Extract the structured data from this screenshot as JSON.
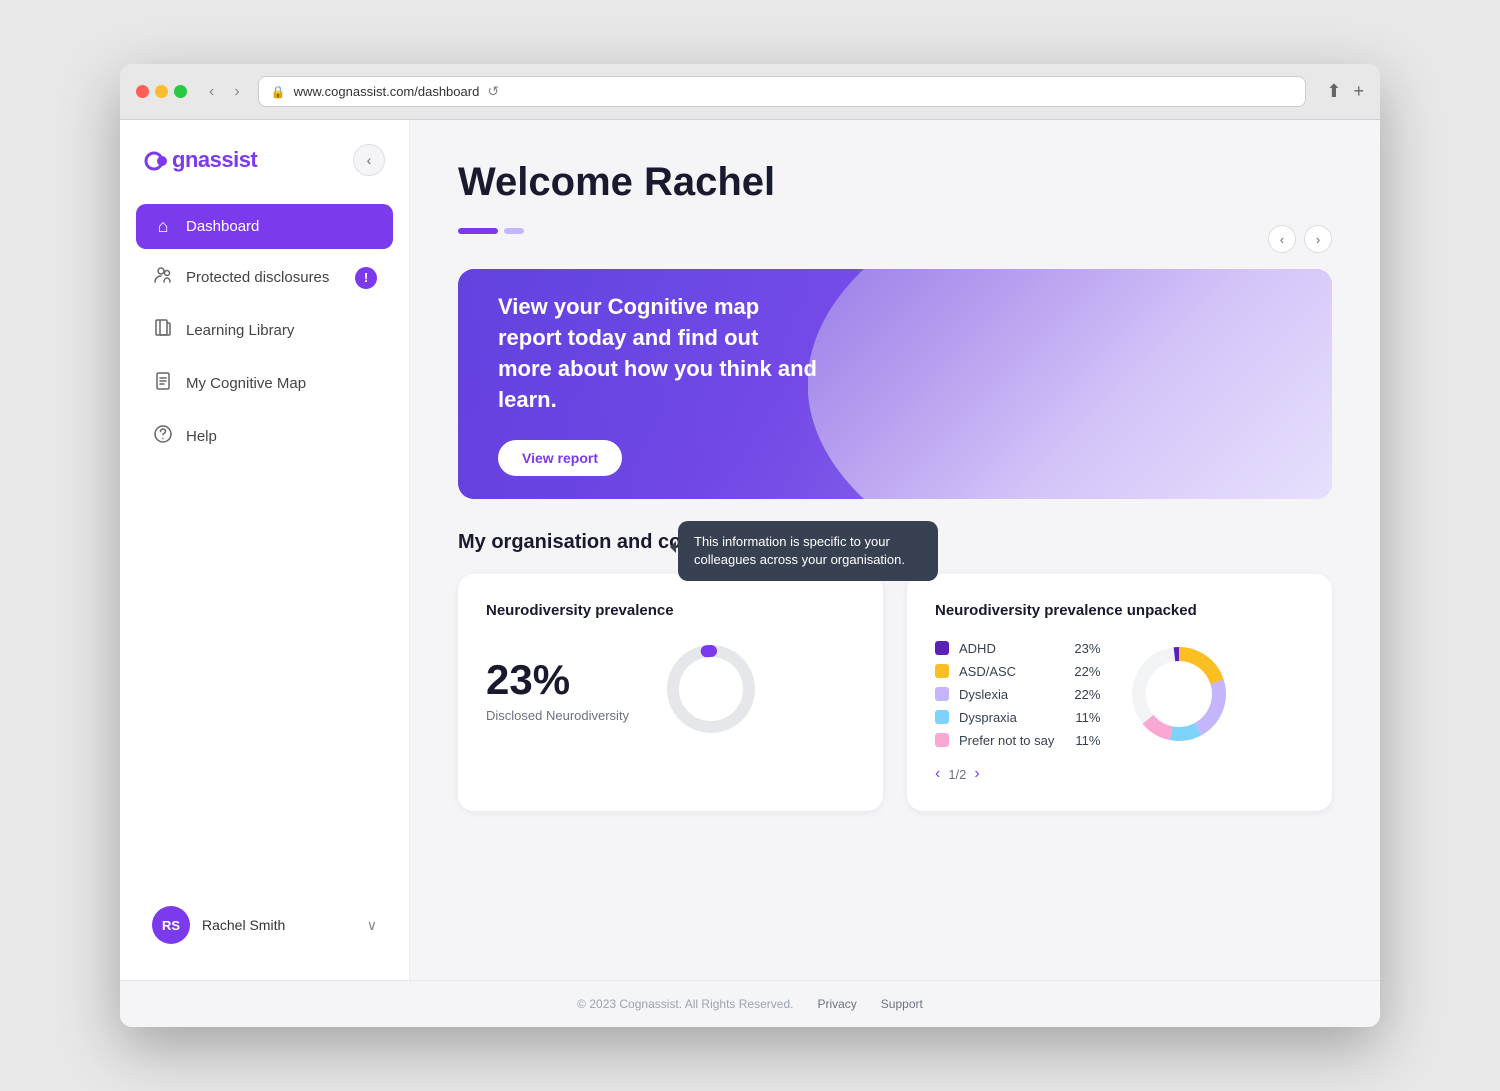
{
  "browser": {
    "url": "www.cognassist.com/dashboard",
    "back_btn": "‹",
    "forward_btn": "›",
    "reload": "↺",
    "share": "⬆",
    "new_tab": "+"
  },
  "sidebar": {
    "logo_prefix": "co",
    "logo_suffix": "gnassist",
    "collapse_icon": "‹",
    "nav_items": [
      {
        "id": "dashboard",
        "label": "Dashboard",
        "icon": "⌂",
        "active": true,
        "badge": null
      },
      {
        "id": "protected-disclosures",
        "label": "Protected disclosures",
        "icon": "👤",
        "active": false,
        "badge": "!"
      },
      {
        "id": "learning-library",
        "label": "Learning Library",
        "icon": "📖",
        "active": false,
        "badge": null
      },
      {
        "id": "my-cognitive-map",
        "label": "My Cognitive Map",
        "icon": "📄",
        "active": false,
        "badge": null
      },
      {
        "id": "help",
        "label": "Help",
        "icon": "?",
        "active": false,
        "badge": null
      }
    ],
    "user": {
      "initials": "RS",
      "name": "Rachel Smith",
      "chevron": "∨"
    }
  },
  "main": {
    "welcome_title": "Welcome Rachel",
    "carousel": {
      "prev_btn": "‹",
      "next_btn": "›",
      "hero_text": "View your Cognitive map report today and find out more about how you think and learn.",
      "hero_btn_label": "View report"
    },
    "org_section": {
      "title": "My organisation and colleagues",
      "help_icon": "?",
      "tooltip": "This information is specific to your colleagues across your organisation."
    },
    "neurodiversity_prevalence": {
      "card_title": "Neurodiversity prevalence",
      "percentage": "23%",
      "label": "Disclosed Neurodiversity",
      "donut_value": 23,
      "donut_color": "#7c3aed",
      "donut_bg": "#e5e7eb"
    },
    "neurodiversity_unpacked": {
      "card_title": "Neurodiversity prevalence unpacked",
      "items": [
        {
          "label": "ADHD",
          "pct": "23%",
          "color": "#5b21b6"
        },
        {
          "label": "ASD/ASC",
          "pct": "22%",
          "color": "#fbbf24"
        },
        {
          "label": "Dyslexia",
          "pct": "22%",
          "color": "#c4b5fd"
        },
        {
          "label": "Dyspraxia",
          "pct": "11%",
          "color": "#7dd3fc"
        },
        {
          "label": "Prefer not to say",
          "pct": "11%",
          "color": "#f9a8d4"
        }
      ],
      "pagination": "‹ 1/2 ›"
    }
  },
  "footer": {
    "copyright": "© 2023 Cognassist. All Rights Reserved.",
    "links": [
      "Privacy",
      "Support"
    ]
  }
}
